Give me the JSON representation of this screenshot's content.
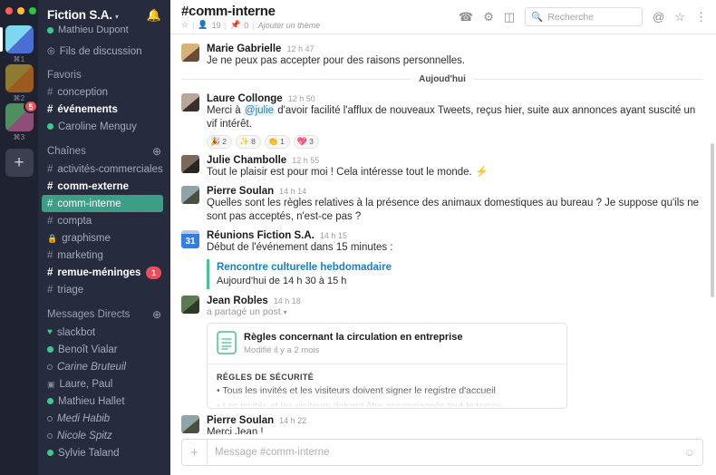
{
  "rail": {
    "workspaces": [
      {
        "key": "⌘1",
        "selected": true,
        "badge": null,
        "c1": "#7fd7ef",
        "c2": "#4a6fd0"
      },
      {
        "key": "⌘2",
        "selected": false,
        "badge": null,
        "c1": "#8f7a33",
        "c2": "#9c5a1e"
      },
      {
        "key": "⌘3",
        "selected": false,
        "badge": "5",
        "c1": "#4f8f5f",
        "c2": "#8e4e7a"
      }
    ],
    "add_label": "+"
  },
  "sidebar": {
    "team_name": "Fiction S.A.",
    "caret": "▾",
    "bell_icon": "bell-icon",
    "user": "Mathieu Dupont",
    "threads": "Fils de discussion",
    "sections": [
      {
        "title": "Favoris",
        "add": null,
        "items": [
          {
            "type": "channel",
            "label": "conception",
            "bold": false
          },
          {
            "type": "channel",
            "label": "événements",
            "bold": true
          },
          {
            "type": "presence",
            "label": "Caroline Menguy",
            "online": true,
            "bold": false
          }
        ]
      },
      {
        "title": "Chaînes",
        "add": "+",
        "items": [
          {
            "type": "channel",
            "label": "activités-commerciales",
            "bold": false
          },
          {
            "type": "channel",
            "label": "comm-externe",
            "bold": true
          },
          {
            "type": "channel",
            "label": "comm-interne",
            "bold": false,
            "active": true
          },
          {
            "type": "channel",
            "label": "compta",
            "bold": false
          },
          {
            "type": "private",
            "label": "graphisme",
            "bold": false
          },
          {
            "type": "channel",
            "label": "marketing",
            "bold": false
          },
          {
            "type": "channel",
            "label": "remue-méninges",
            "bold": true,
            "badge": "1"
          },
          {
            "type": "channel",
            "label": "triage",
            "bold": false
          }
        ]
      },
      {
        "title": "Messages Directs",
        "add": "+",
        "items": [
          {
            "type": "bot",
            "label": "slackbot",
            "bold": false
          },
          {
            "type": "presence",
            "label": "Benoît Vialar",
            "online": true
          },
          {
            "type": "presence",
            "label": "Carine Bruteuil",
            "online": false,
            "italic": true
          },
          {
            "type": "group",
            "label": "Laure, Paul"
          },
          {
            "type": "presence",
            "label": "Mathieu Hallet",
            "online": true
          },
          {
            "type": "presence",
            "label": "Medi Habib",
            "online": false,
            "italic": true
          },
          {
            "type": "presence",
            "label": "Nicole Spitz",
            "online": false,
            "italic": true
          },
          {
            "type": "presence",
            "label": "Sylvie Taland",
            "online": true
          }
        ]
      }
    ]
  },
  "header": {
    "channel": "#comm-interne",
    "star_icon": "star-outline-icon",
    "members_icon": "person-icon",
    "members_count": "19",
    "pin_icon": "pin-icon",
    "pin_count": "0",
    "topic": "Ajouter un thème",
    "icons": [
      "phone-icon",
      "gear-icon",
      "panel-icon"
    ],
    "search_placeholder": "Recherche",
    "search_value": "",
    "right_icons": [
      "at-mention-icon",
      "star-outline-icon",
      "kebab-menu-icon"
    ]
  },
  "messages": [
    {
      "id": "m1",
      "author": "Marie Gabrielle",
      "time": "12 h 47",
      "text": "Je ne peux pas accepter pour des raisons personnelles.",
      "av1": "#d9b27a",
      "av2": "#6b4b33"
    },
    {
      "id": "m2",
      "author": "Laure Collonge",
      "time": "12 h 50",
      "text_before": "Merci à ",
      "mention": "@julie",
      "text_after": " d'avoir facilité l'afflux de nouveaux Tweets, reçus hier, suite aux annonces ayant suscité un vif intérêt.",
      "av1": "#b9a79a",
      "av2": "#3a2f2c",
      "reactions": [
        {
          "emoji": "🎉",
          "name": "tada-reaction",
          "count": "2"
        },
        {
          "emoji": "✨",
          "name": "sparkles-reaction",
          "count": "8"
        },
        {
          "emoji": "👏",
          "name": "clap-reaction",
          "count": "1"
        },
        {
          "emoji": "💖",
          "name": "heart-reaction",
          "count": "3"
        }
      ]
    },
    {
      "id": "m3",
      "author": "Julie Chambolle",
      "time": "12 h 55",
      "text": "Tout le plaisir est pour moi ! Cela intéresse tout le monde. ⚡",
      "av1": "#7a6a5d",
      "av2": "#2b2420"
    },
    {
      "id": "m4",
      "author": "Pierre Soulan",
      "time": "14 h 14",
      "text": "Quelles sont les règles relatives à la présence des animaux domestiques au bureau ? Je suppose qu'ils ne sont pas acceptés, n'est-ce pas ?",
      "av1": "#8fa3a8",
      "av2": "#4a5040"
    },
    {
      "id": "m5",
      "author": "Réunions Fiction S.A.",
      "time": "14 h 15",
      "text": "Début de l'événement dans 15 minutes :",
      "calendar_day": "31",
      "event": {
        "title": "Rencontre culturelle hebdomadaire",
        "when": "Aujourd'hui de 14 h 30 à 15 h"
      }
    },
    {
      "id": "m6",
      "author": "Jean Robles",
      "time": "14 h 18",
      "shared": "a partagé un post",
      "caret": "▾",
      "av1": "#5e7a52",
      "av2": "#2e3a28",
      "card": {
        "icon": "document-icon",
        "title": "Règles concernant la circulation en entreprise",
        "meta": "Modifié il y a 2 mois",
        "section": "RÈGLES DE SÉCURITÉ",
        "bullets": [
          "• Tous les invités et les visiteurs doivent signer le registre d'accueil",
          "• Les invités et les visiteurs doivent être accompagnés tout le temps"
        ]
      }
    },
    {
      "id": "m7",
      "author": "Pierre Soulan",
      "time": "14 h 22",
      "text": "Merci Jean !",
      "av1": "#8fa3a8",
      "av2": "#4a5040"
    }
  ],
  "day_divider": "Aujoud'hui",
  "composer": {
    "plus": "+",
    "placeholder": "Message #comm-interne",
    "value": "",
    "emoji_icon": "emoji-icon"
  },
  "colors": {
    "accent_active": "#3c9e87",
    "badge_red": "#eb4d5c",
    "sidebar_bg": "#262b3e",
    "rail_bg": "#1f2331",
    "link_blue": "#1d7fbf"
  }
}
